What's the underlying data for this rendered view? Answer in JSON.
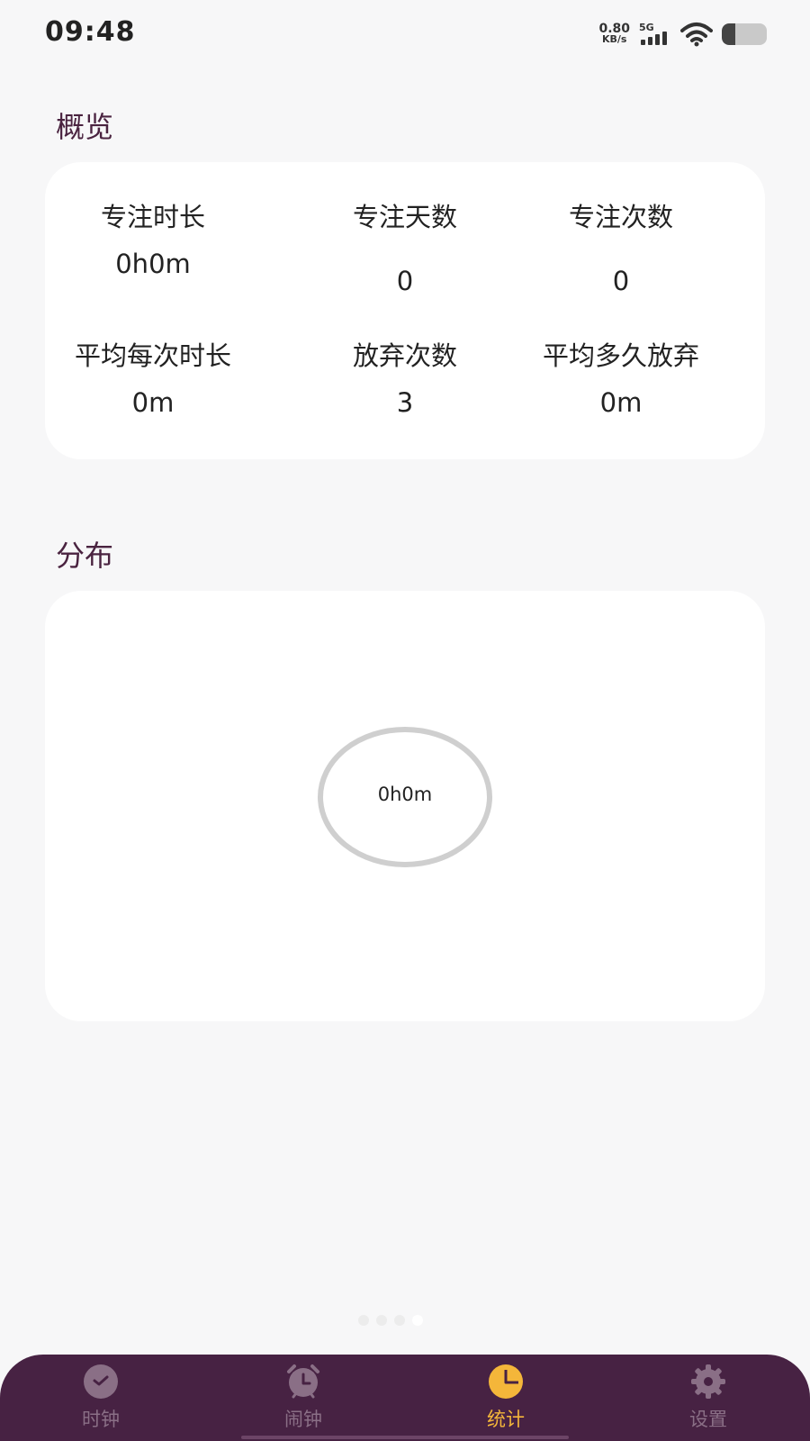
{
  "status_bar": {
    "time": "09:48",
    "net_speed_value": "0.80",
    "net_speed_unit": "KB/s",
    "network_type": "5G",
    "battery_level": 0.3,
    "icons": [
      "signal-icon",
      "wifi-icon",
      "battery-icon"
    ]
  },
  "overview": {
    "title": "概览",
    "stats": [
      {
        "label": "专注时长",
        "value": "0h0m"
      },
      {
        "label": "专注天数",
        "value": "0"
      },
      {
        "label": "专注次数",
        "value": "0"
      },
      {
        "label": "平均每次时长",
        "value": "0m"
      },
      {
        "label": "放弃次数",
        "value": "3"
      },
      {
        "label": "平均多久放弃",
        "value": "0m"
      }
    ]
  },
  "distribution": {
    "title": "分布",
    "center_label": "0h0m"
  },
  "page_indicator": {
    "count": 4,
    "active_index": 3
  },
  "nav": {
    "items": [
      {
        "label": "时钟",
        "icon": "clock-icon",
        "active": false
      },
      {
        "label": "闹钟",
        "icon": "alarm-icon",
        "active": false
      },
      {
        "label": "统计",
        "icon": "pie-chart-icon",
        "active": true
      },
      {
        "label": "设置",
        "icon": "gear-icon",
        "active": false
      }
    ]
  },
  "colors": {
    "nav_background": "#472243",
    "accent": "#f4b63a",
    "title": "#4a2340",
    "ring": "#cfcfcf"
  }
}
